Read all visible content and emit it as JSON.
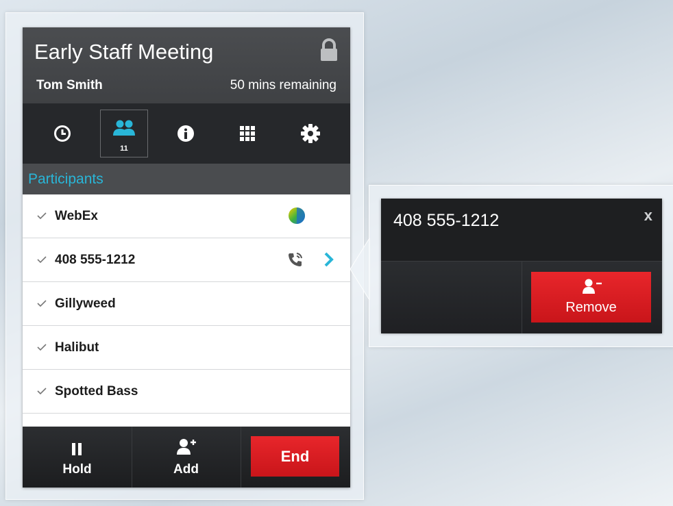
{
  "meeting": {
    "title": "Early Staff Meeting",
    "organizer": "Tom Smith",
    "time_remaining": "50 mins remaining"
  },
  "toolbar": {
    "participant_count": "11",
    "icons": [
      "clock-icon",
      "participants-icon",
      "info-icon",
      "keypad-icon",
      "gear-icon"
    ],
    "active": "participants"
  },
  "section": {
    "title": "Participants"
  },
  "participants": [
    {
      "name": "WebEx",
      "icon": "webex-globe-icon"
    },
    {
      "name": "408 555-1212",
      "icon": "phone-call-icon",
      "selected": true
    },
    {
      "name": "Gillyweed"
    },
    {
      "name": "Halibut"
    },
    {
      "name": "Spotted Bass"
    }
  ],
  "bottom_bar": {
    "hold_label": "Hold",
    "add_label": "Add",
    "end_label": "End"
  },
  "popup": {
    "number": "408 555-1212",
    "close_label": "x",
    "remove_label": "Remove"
  },
  "colors": {
    "accent": "#29b6d8",
    "danger": "#d81b20",
    "header": "#454749",
    "toolbar": "#26282b"
  }
}
